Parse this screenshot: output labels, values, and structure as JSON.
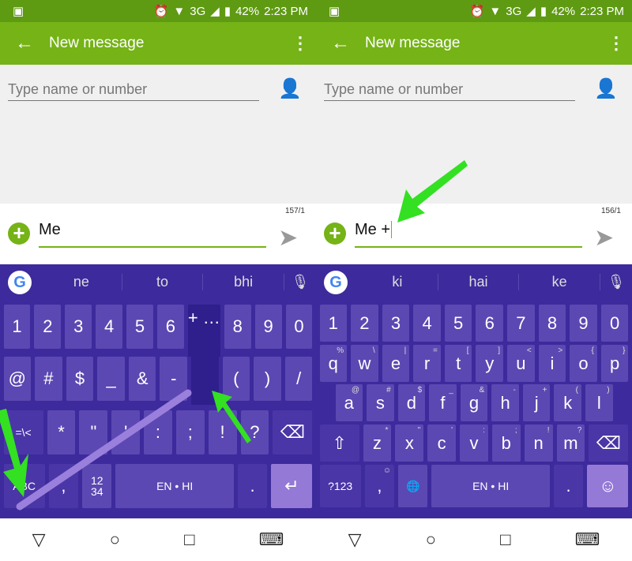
{
  "phones": [
    {
      "status": {
        "time": "2:23 PM",
        "battery": "42%",
        "network": "3G"
      },
      "toolbar": {
        "title": "New message"
      },
      "recipient": {
        "placeholder": "Type name or number"
      },
      "compose": {
        "counter": "157/1",
        "text": "Me"
      },
      "suggestions": [
        "ne",
        "to",
        "bhi"
      ],
      "keyboard": [
        [
          [
            "1"
          ],
          [
            "2"
          ],
          [
            "3"
          ],
          [
            "4"
          ],
          [
            "5"
          ],
          [
            "6"
          ],
          [
            "+ …",
            "popup"
          ],
          [
            "8"
          ],
          [
            "9"
          ],
          [
            "0"
          ]
        ],
        [
          [
            "@"
          ],
          [
            "#"
          ],
          [
            "$"
          ],
          [
            "_"
          ],
          [
            "&"
          ],
          [
            "-"
          ],
          [
            "",
            "popup"
          ],
          [
            "("
          ],
          [
            ")"
          ],
          [
            "/"
          ]
        ],
        [
          [
            "=\\<",
            "dark small",
            1.4
          ],
          [
            "*"
          ],
          [
            "\""
          ],
          [
            "'"
          ],
          [
            ":"
          ],
          [
            ";"
          ],
          [
            "!"
          ],
          [
            "?"
          ],
          [
            "⌫",
            "dark",
            1.4
          ]
        ],
        [
          [
            "ABC",
            "dark small",
            1.4
          ],
          [
            ",",
            "dark"
          ],
          [
            "12\n34",
            "small"
          ],
          [
            "EN • HI",
            "small",
            4
          ],
          [
            ".",
            "dark"
          ],
          [
            "↵",
            "light",
            1.4
          ]
        ]
      ]
    },
    {
      "status": {
        "time": "2:23 PM",
        "battery": "42%",
        "network": "3G"
      },
      "toolbar": {
        "title": "New message"
      },
      "recipient": {
        "placeholder": "Type name or number"
      },
      "compose": {
        "counter": "156/1",
        "text": "Me +"
      },
      "suggestions": [
        "ki",
        "hai",
        "ke"
      ],
      "keyboard": [
        [
          [
            "1"
          ],
          [
            "2"
          ],
          [
            "3"
          ],
          [
            "4"
          ],
          [
            "5"
          ],
          [
            "6"
          ],
          [
            "7"
          ],
          [
            "8"
          ],
          [
            "9"
          ],
          [
            "0"
          ]
        ],
        [
          [
            "q",
            "",
            "",
            "%"
          ],
          [
            "w",
            "",
            "",
            "\\"
          ],
          [
            "e",
            "",
            "",
            "|"
          ],
          [
            "r",
            "",
            "",
            "="
          ],
          [
            "t",
            "",
            "",
            "["
          ],
          [
            "y",
            "",
            "",
            "]"
          ],
          [
            "u",
            "",
            "",
            "<"
          ],
          [
            "i",
            "",
            "",
            ">"
          ],
          [
            "o",
            "",
            "",
            "{"
          ],
          [
            "p",
            "",
            "",
            "}"
          ]
        ],
        [
          [
            "a",
            "",
            "",
            "@"
          ],
          [
            "s",
            "",
            "",
            "#"
          ],
          [
            "d",
            "",
            "",
            "$"
          ],
          [
            "f",
            "",
            "",
            "_"
          ],
          [
            "g",
            "",
            "",
            "&"
          ],
          [
            "h",
            "",
            "",
            "-"
          ],
          [
            "j",
            "",
            "",
            "+"
          ],
          [
            "k",
            "",
            "",
            "("
          ],
          [
            "l",
            "",
            "",
            ")"
          ]
        ],
        [
          [
            "⇧",
            "dark",
            1.4
          ],
          [
            "z",
            "",
            "",
            "*"
          ],
          [
            "x",
            "",
            "",
            "\""
          ],
          [
            "c",
            "",
            "",
            "'"
          ],
          [
            "v",
            "",
            "",
            ":"
          ],
          [
            "b",
            "",
            "",
            ";"
          ],
          [
            "n",
            "",
            "",
            "!"
          ],
          [
            "m",
            "",
            "",
            "?"
          ],
          [
            "⌫",
            "dark",
            1.4
          ]
        ],
        [
          [
            "?123",
            "dark small",
            1.4
          ],
          [
            ",",
            "dark",
            "",
            "☺"
          ],
          [
            "🌐",
            "small"
          ],
          [
            "EN • HI",
            "small",
            4
          ],
          [
            ".",
            "dark"
          ],
          [
            "☺",
            "light",
            1.4
          ]
        ]
      ]
    }
  ],
  "colors": {
    "statusbar": "#5f9a13",
    "toolbar": "#75b316",
    "keyboard": "#3d2a9c",
    "key": "#5c48b2",
    "arrow": "#33e022"
  }
}
